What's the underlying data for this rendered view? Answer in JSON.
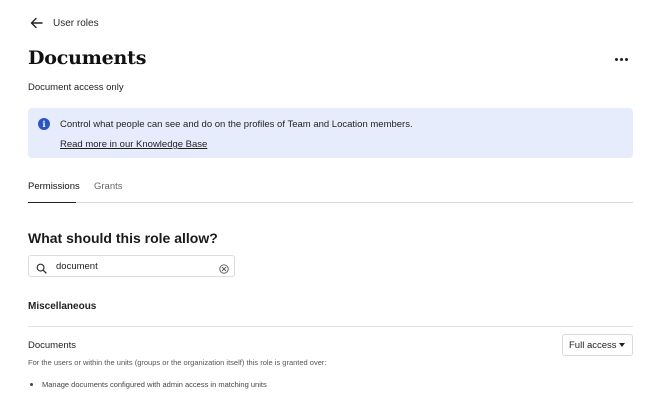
{
  "header": {
    "back_label": "User roles"
  },
  "page": {
    "title": "Documents",
    "subtitle": "Document access only",
    "menu_icon": "more-horizontal-icon"
  },
  "banner": {
    "icon": "info-icon",
    "icon_glyph": "i",
    "message": "Control what people can see and do on the profiles of Team and Location members.",
    "link_text": "Read more in our Knowledge Base",
    "background_color": "#e6ecfb",
    "accent_color": "#2b55c4"
  },
  "tabs": [
    {
      "label": "Permissions",
      "active": true
    },
    {
      "label": "Grants",
      "active": false
    }
  ],
  "permissions_section": {
    "question": "What should this role allow?",
    "search": {
      "value": "document",
      "icon": "search-icon",
      "clear_icon": "clear-icon"
    },
    "group_title": "Miscellaneous",
    "items": [
      {
        "name": "Documents",
        "description": "For the users or within the units (groups or the organization itself) this role is granted over:",
        "bullets": [
          "Manage documents configured with admin access in matching units"
        ],
        "access_level": "Full access"
      }
    ]
  }
}
